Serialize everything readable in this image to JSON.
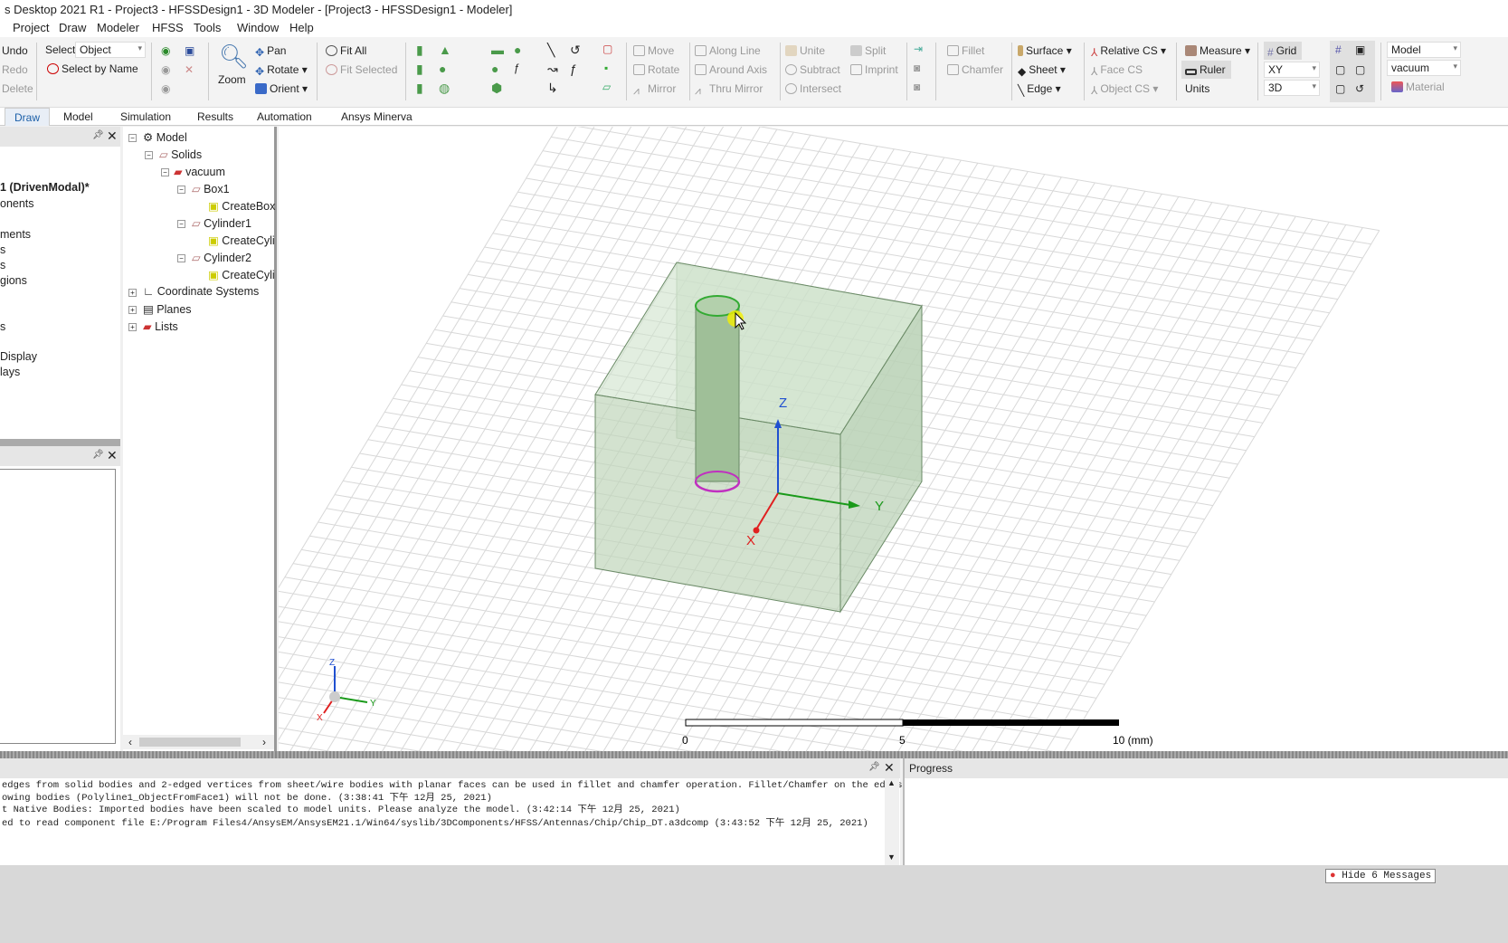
{
  "title": "s Desktop 2021 R1 - Project3 - HFSSDesign1 - 3D Modeler - [Project3 - HFSSDesign1 - Modeler]",
  "menu": [
    "Project",
    "Draw",
    "Modeler",
    "HFSS",
    "Tools",
    "Window",
    "Help"
  ],
  "ribbon": {
    "edit": [
      "Undo",
      "Redo",
      "Delete"
    ],
    "select_label": "Select:",
    "select_value": "Object",
    "select_by_name": "Select by Name",
    "zoom": "Zoom",
    "pan": "Pan",
    "rotate": "Rotate",
    "orient": "Orient",
    "fit_all": "Fit All",
    "fit_selected": "Fit Selected",
    "move": "Move",
    "rotate2": "Rotate",
    "mirror": "Mirror",
    "along_line": "Along Line",
    "around_axis": "Around Axis",
    "thru_mirror": "Thru Mirror",
    "unite": "Unite",
    "subtract": "Subtract",
    "intersect": "Intersect",
    "split": "Split",
    "imprint": "Imprint",
    "fillet": "Fillet",
    "chamfer": "Chamfer",
    "surface": "Surface",
    "sheet": "Sheet",
    "edge": "Edge",
    "relative_cs": "Relative CS",
    "face_cs": "Face CS",
    "object_cs": "Object CS",
    "measure": "Measure",
    "ruler": "Ruler",
    "units": "Units",
    "grid": "Grid",
    "plane": "XY",
    "dim": "3D",
    "model": "Model",
    "material_value": "vacuum",
    "material": "Material"
  },
  "tabs": [
    "Draw",
    "Model",
    "Simulation",
    "Results",
    "Automation",
    "Ansys Minerva"
  ],
  "left_panel": [
    "1 (DrivenModal)*",
    "onents",
    "ments",
    "s",
    "s",
    "gions",
    "s",
    "Display",
    "lays"
  ],
  "tree": [
    "Model",
    "Solids",
    "vacuum",
    "Box1",
    "CreateBox",
    "Cylinder1",
    "CreateCyli",
    "Cylinder2",
    "CreateCyli",
    "Coordinate Systems",
    "Planes",
    "Lists"
  ],
  "viewport": {
    "axes": [
      "X",
      "Y",
      "Z"
    ],
    "scale": [
      "0",
      "5",
      "10 (mm)"
    ]
  },
  "messages": [
    "edges from solid bodies and 2-edged vertices from sheet/wire bodies with planar faces can be used in fillet and chamfer operation. Fillet/Chamfer on the edges of the",
    "owing bodies (Polyline1_ObjectFromFace1) will not be done. (3:38:41 下午  12月 25, 2021)",
    "t Native Bodies: Imported bodies have been scaled to model units. Please analyze the model. (3:42:14 下午  12月 25, 2021)",
    "ed to read component file E:/Program Files4/AnsysEM/AnsysEM21.1/Win64/syslib/3DComponents/HFSS/Antennas/Chip/Chip_DT.a3dcomp (3:43:52 下午  12月 25, 2021)"
  ],
  "progress_title": "Progress",
  "status_button": "Hide 6 Messages",
  "colors": {
    "box_fill": "#c8dcc4",
    "box_edge": "#6a8a66",
    "cylinder": "#9fbf98",
    "axis_x": "#e02020",
    "axis_y": "#1a9a1a",
    "axis_z": "#2050d0",
    "tab_active": "#1b5fa8"
  }
}
